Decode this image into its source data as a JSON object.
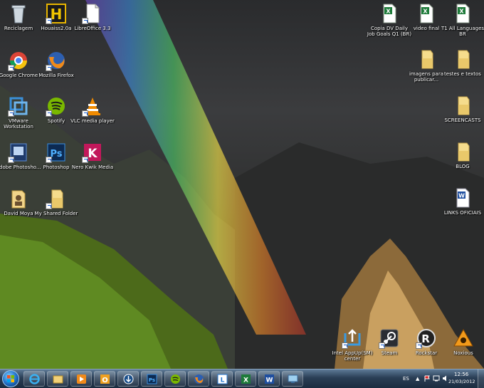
{
  "desktop_icons": [
    {
      "label": "Reciclagem",
      "icon": "recycle-bin-icon"
    },
    {
      "label": "Houaiss2.0a",
      "icon": "houaiss-icon"
    },
    {
      "label": "LibreOffice 3.3",
      "icon": "libreoffice-icon"
    },
    {
      "label": "Google Chrome",
      "icon": "chrome-icon"
    },
    {
      "label": "Mozilla Firefox",
      "icon": "firefox-icon"
    },
    {
      "label": "VMware Workstation",
      "icon": "vmware-icon"
    },
    {
      "label": "Spotify",
      "icon": "spotify-icon"
    },
    {
      "label": "VLC media player",
      "icon": "vlc-icon"
    },
    {
      "label": "Adobe Photosho...",
      "icon": "photoshop-icon"
    },
    {
      "label": "Photoshop",
      "icon": "photoshop-icon"
    },
    {
      "label": "Nero Kwik Media",
      "icon": "nero-icon"
    },
    {
      "label": "David Moya",
      "icon": "user-folder-icon"
    },
    {
      "label": "My Shared Folder",
      "icon": "folder-icon"
    },
    {
      "label": "Copia DV Daily Job Goals Q1 (BR)",
      "icon": "excel-file-icon"
    },
    {
      "label": "video final",
      "icon": "excel-file-icon"
    },
    {
      "label": "T1 All Languages BR",
      "icon": "excel-file-icon"
    },
    {
      "label": "imagens para publicar...",
      "icon": "folder-icon"
    },
    {
      "label": "testes e textos",
      "icon": "folder-icon"
    },
    {
      "label": "SCREENCASTS",
      "icon": "folder-icon"
    },
    {
      "label": "BLOG",
      "icon": "folder-icon"
    },
    {
      "label": "LINKS OFICIAIS",
      "icon": "word-file-icon"
    },
    {
      "label": "Intel AppUp(SM) center",
      "icon": "intel-appup-icon"
    },
    {
      "label": "Steam",
      "icon": "steam-icon"
    },
    {
      "label": "Rockstar",
      "icon": "rockstar-icon"
    },
    {
      "label": "Noxious",
      "icon": "noxious-icon"
    }
  ],
  "taskbar": {
    "pinned": [
      "internet-explorer-icon",
      "folder-icon",
      "media-player-icon",
      "outlook-icon",
      "thunderbird-icon",
      "photoshop-icon",
      "spotify-icon",
      "firefox-icon",
      "lync-icon",
      "excel-icon",
      "word-icon",
      "remote-desktop-icon"
    ],
    "language": "ES",
    "time": "12:56",
    "date": "21/03/2012"
  }
}
